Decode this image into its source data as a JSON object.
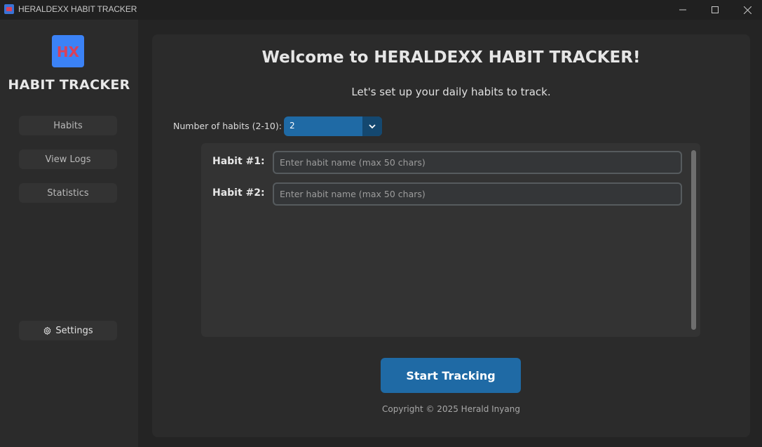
{
  "window": {
    "title": "HERALDEXX HABIT TRACKER"
  },
  "sidebar": {
    "brand": "HABIT TRACKER",
    "items": [
      {
        "label": "Habits"
      },
      {
        "label": "View Logs"
      },
      {
        "label": "Statistics"
      }
    ],
    "settings_label": "Settings"
  },
  "main": {
    "welcome": "Welcome to HERALDEXX HABIT TRACKER!",
    "subtitle": "Let's set up your daily habits to track.",
    "num_habits_label": "Number of habits (2-10):",
    "num_habits_value": "2",
    "habits": [
      {
        "label": "Habit #1:",
        "placeholder": "Enter habit name (max 50 chars)",
        "value": ""
      },
      {
        "label": "Habit #2:",
        "placeholder": "Enter habit name (max 50 chars)",
        "value": ""
      }
    ],
    "start_button": "Start Tracking",
    "copyright": "Copyright © 2025 Herald Inyang"
  },
  "colors": {
    "accent": "#1f6aa5",
    "accent_dark": "#144870",
    "logo_bg": "#3b82f6",
    "logo_mark": "#d9415a",
    "window_bg": "#242424",
    "panel_bg": "#2b2b2b"
  },
  "icons": {
    "app": "app-logo-icon",
    "minimize": "minimize-icon",
    "maximize": "maximize-icon",
    "close": "close-icon",
    "settings": "gear-icon",
    "dropdown": "chevron-down-icon"
  }
}
